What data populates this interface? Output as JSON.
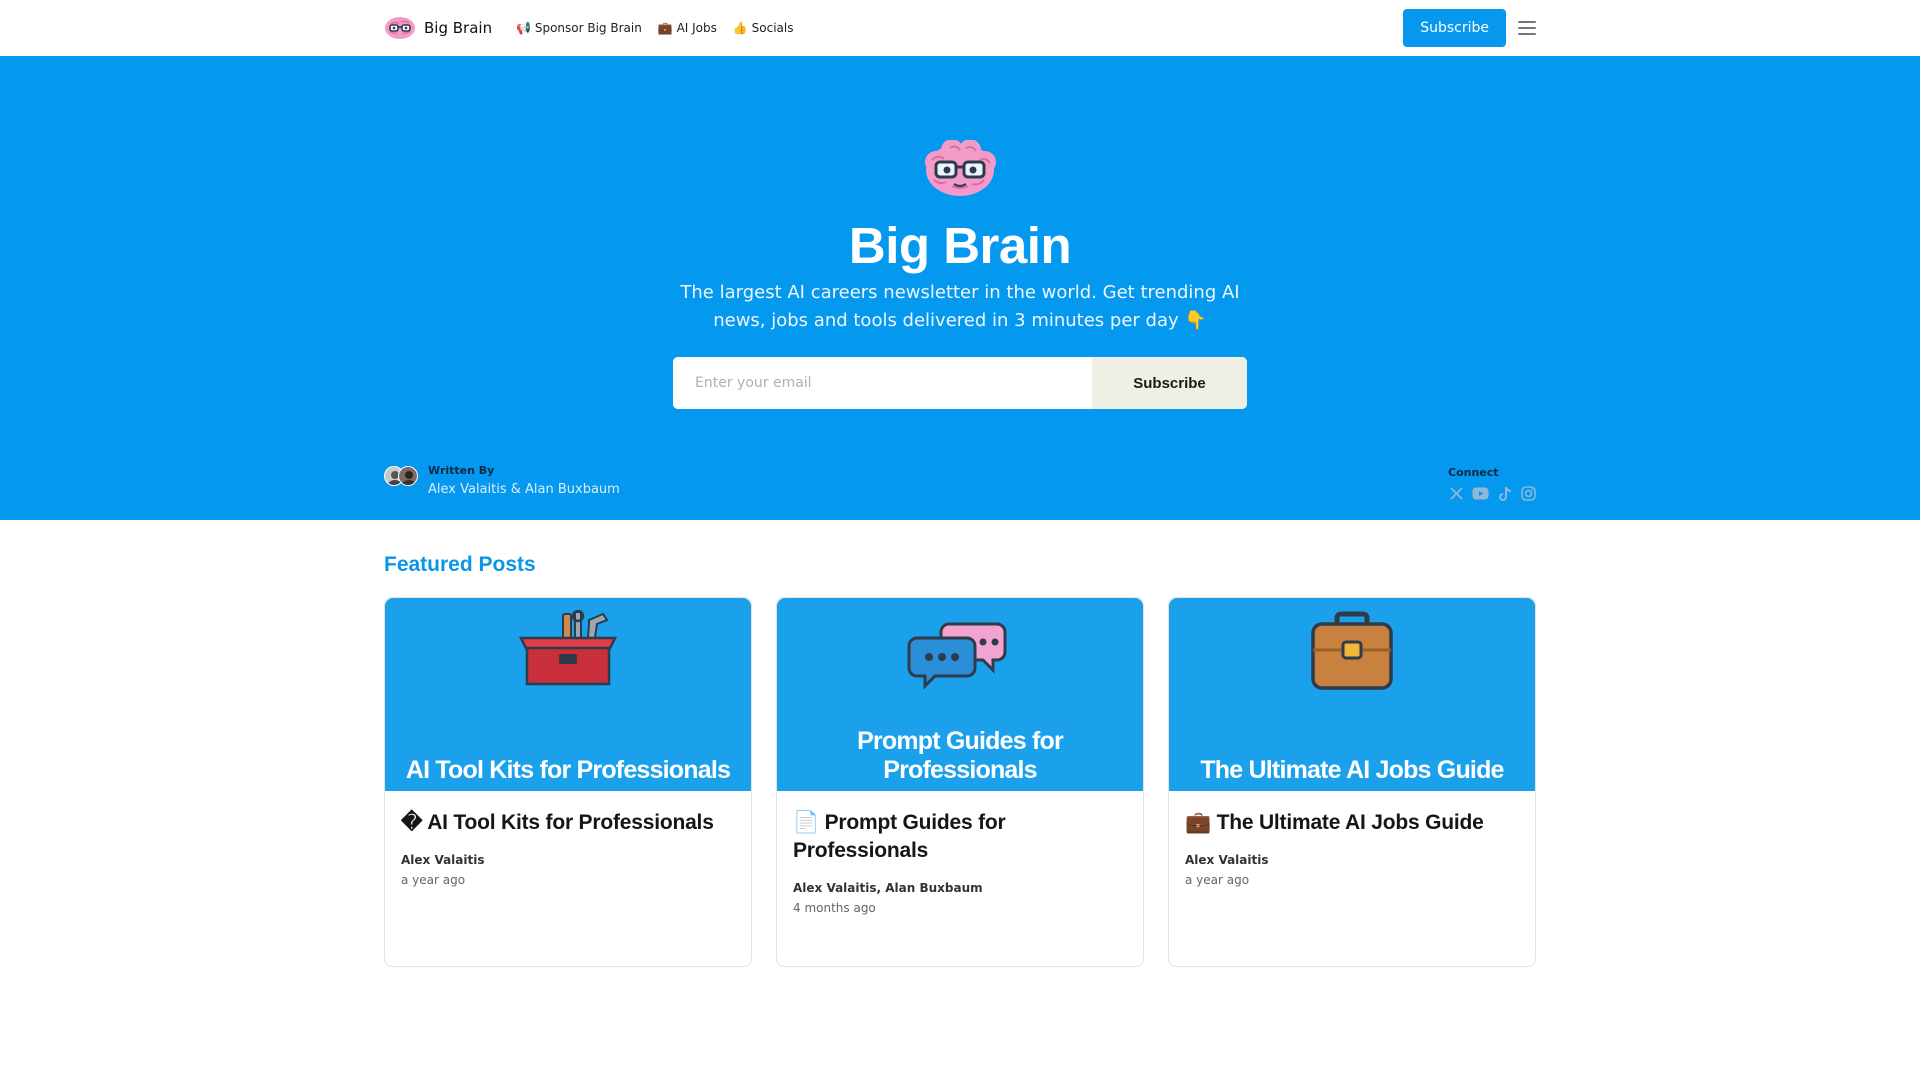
{
  "nav": {
    "brand": "Big Brain",
    "links": [
      {
        "label": "📢 Sponsor Big Brain",
        "icon": "megaphone-icon"
      },
      {
        "label": "💼 AI Jobs",
        "icon": "briefcase-icon"
      },
      {
        "label": "👍 Socials",
        "icon": "thumbs-up-icon"
      }
    ],
    "subscribe_label": "Subscribe",
    "menu_icon": "hamburger-menu-icon"
  },
  "hero": {
    "background": "#0598ef",
    "title": "Big Brain",
    "description": "The largest AI careers newsletter in the world. Get trending AI news, jobs and tools delivered in 3 minutes per day 👇",
    "email_placeholder": "Enter your email",
    "email_value": "",
    "subscribe_label": "Subscribe",
    "written_by_label": "Written By",
    "authors": "Alex Valaitis & Alan Buxbaum",
    "connect_label": "Connect",
    "socials": [
      "x-icon",
      "youtube-icon",
      "tiktok-icon",
      "instagram-icon"
    ]
  },
  "featured": {
    "heading": "Featured Posts",
    "accent": "#0a96e6",
    "posts": [
      {
        "thumb_title": "AI Tool Kits for Professionals",
        "thumb_icon": "toolbox-icon",
        "title": "� AI Tool Kits for Professionals",
        "author": "Alex Valaitis",
        "date": "a year ago"
      },
      {
        "thumb_title": "Prompt Guides for Professionals",
        "thumb_icon": "chat-bubbles-icon",
        "title": "📄 Prompt Guides for Professionals",
        "author": "Alex Valaitis, Alan Buxbaum",
        "date": "4 months ago"
      },
      {
        "thumb_title": "The Ultimate AI Jobs Guide",
        "thumb_icon": "briefcase-icon",
        "title": "💼 The Ultimate AI Jobs Guide",
        "author": "Alex Valaitis",
        "date": "a year ago"
      }
    ]
  }
}
